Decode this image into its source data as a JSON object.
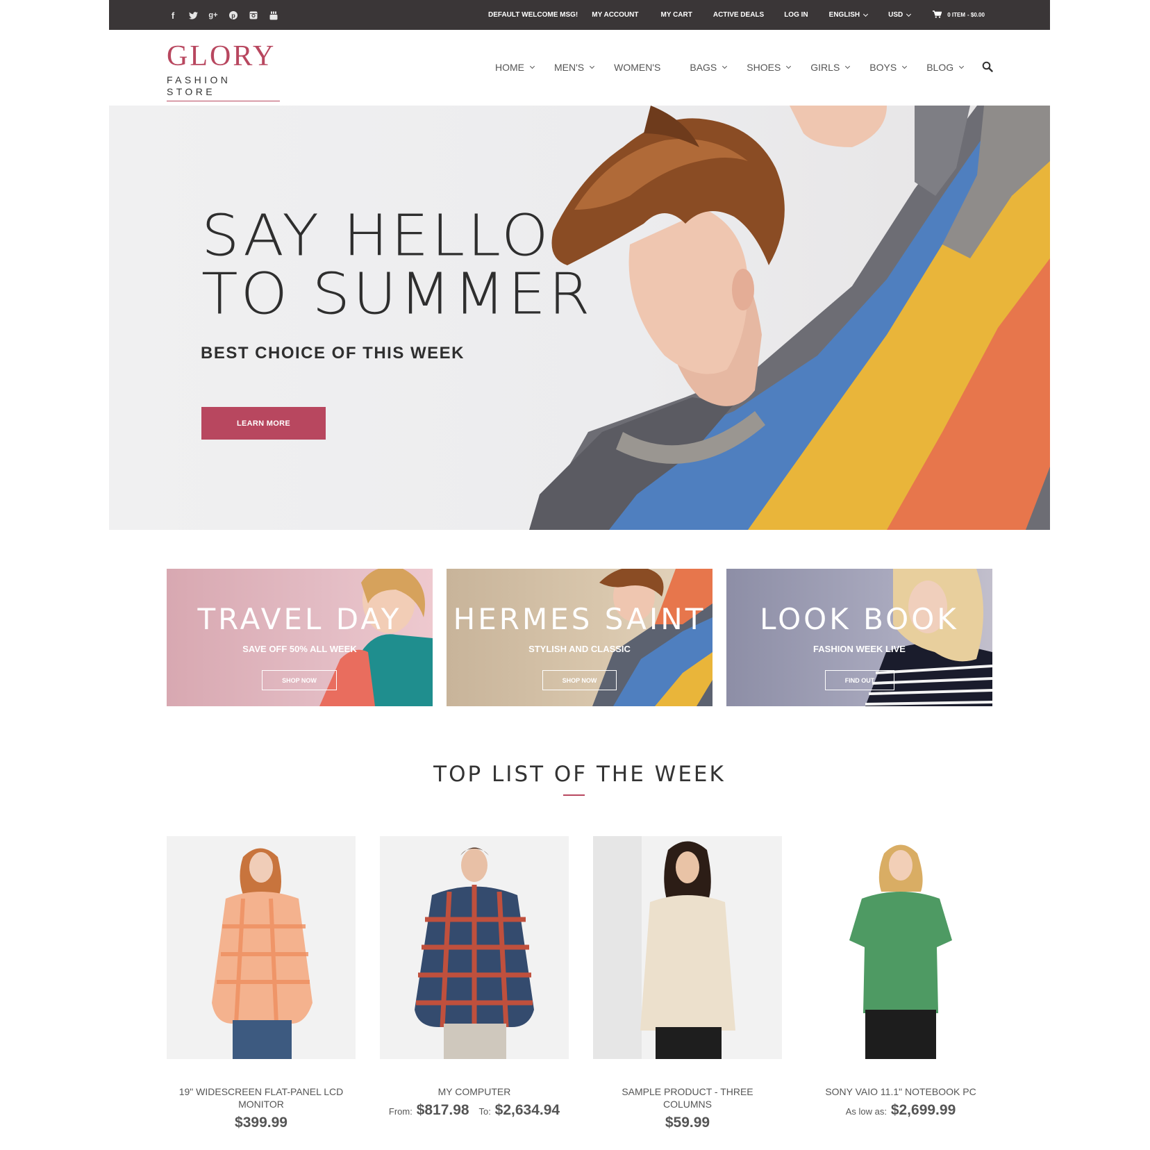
{
  "topbar": {
    "social": [
      {
        "icon": "facebook-icon",
        "glyph": "f"
      },
      {
        "icon": "twitter-icon",
        "glyph": "t"
      },
      {
        "icon": "google-plus-icon",
        "glyph": "g+"
      },
      {
        "icon": "pinterest-icon",
        "glyph": "p"
      },
      {
        "icon": "instagram-icon",
        "glyph": "◙"
      },
      {
        "icon": "youtube-icon",
        "glyph": "▶"
      }
    ],
    "welcome": "DEFAULT WELCOME MSG!",
    "my_account": "MY ACCOUNT",
    "my_cart": "MY CART",
    "active_deals": "ACTIVE DEALS",
    "log_in": "LOG IN",
    "language": "ENGLISH",
    "currency": "USD",
    "cart_items": "0 ITEM",
    "cart_total": "- $0.00"
  },
  "logo": {
    "name": "GLORY",
    "tagline": "FASHION STORE"
  },
  "nav": {
    "home": "HOME",
    "mens": "MEN'S",
    "womens": "WOMEN'S",
    "bags": "BAGS",
    "shoes": "SHOES",
    "girls": "GIRLS",
    "boys": "BOYS",
    "blog": "BLOG"
  },
  "hero": {
    "title_line1": "SAY HELLO",
    "title_line2": "TO SUMMER",
    "subtitle": "BEST CHOICE OF THIS WEEK",
    "button": "LEARN MORE"
  },
  "banners": [
    {
      "title": "TRAVEL DAY",
      "subtitle": "SAVE OFF 50% ALL WEEK",
      "button": "SHOP NOW"
    },
    {
      "title": "HERMES SAINT",
      "subtitle": "STYLISH AND CLASSIC",
      "button": "SHOP NOW"
    },
    {
      "title": "LOOK BOOK",
      "subtitle": "FASHION WEEK LIVE",
      "button": "FIND OUT"
    }
  ],
  "section": {
    "title": "TOP LIST OF THE WEEK"
  },
  "products": [
    {
      "name": "19\" WIDESCREEN FLAT-PANEL LCD MONITOR",
      "price": "$399.99"
    },
    {
      "name": "MY COMPUTER",
      "from_label": "From:",
      "from_price": "$817.98",
      "to_label": "To:",
      "to_price": "$2,634.94"
    },
    {
      "name": "SAMPLE PRODUCT - THREE COLUMNS",
      "price": "$59.99"
    },
    {
      "name": "SONY VAIO 11.1\" NOTEBOOK PC",
      "low_label": "As low as:",
      "low_price": "$2,699.99"
    }
  ],
  "colors": {
    "accent": "#b8475f",
    "topbar": "#3a3637"
  }
}
